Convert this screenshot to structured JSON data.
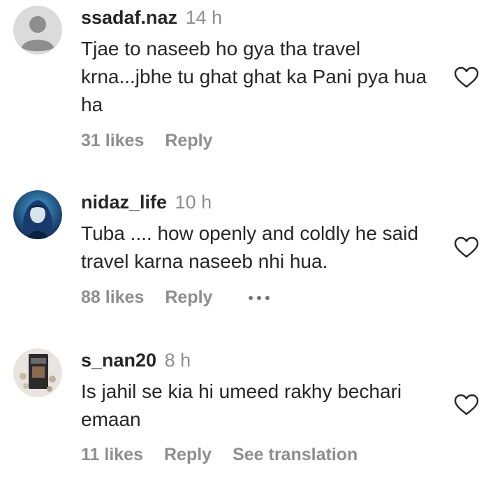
{
  "comments": [
    {
      "username": "ssadaf.naz",
      "time": "14 h",
      "text": "Tjae to naseeb ho gya tha travel krna...jbhe tu ghat ghat ka Pani pya hua ha",
      "likes": "31 likes",
      "reply": "Reply",
      "avatar": "default-avatar-icon"
    },
    {
      "username": "nidaz_life",
      "time": "10 h",
      "text": "Tuba .... how openly and coldly he said travel karna naseeb nhi hua.",
      "likes": "88 likes",
      "reply": "Reply",
      "avatar": "profile-photo"
    },
    {
      "username": "s_nan20",
      "time": "8 h",
      "text": "Is jahil se kia hi umeed rakhy bechari emaan",
      "likes": "11 likes",
      "reply": "Reply",
      "see_translation": "See translation",
      "avatar": "product-photo"
    }
  ],
  "colors": {
    "text": "#262626",
    "secondary": "#8e8e8e",
    "background": "#ffffff"
  }
}
